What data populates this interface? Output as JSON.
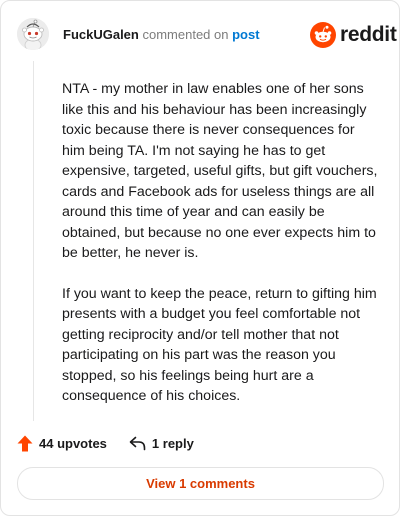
{
  "header": {
    "username": "FuckUGalen",
    "action_text": "commented on",
    "post_link": "post",
    "brand": "reddit",
    "brand_color": "#ff4500"
  },
  "comment": {
    "paragraphs": [
      "NTA - my mother in law enables one of her sons like this and his behaviour has been increasingly toxic because there is never consequences for him being TA. I'm not saying he has to get expensive, targeted, useful gifts, but gift vouchers, cards and Facebook ads for useless things are all around this time of year and can easily be obtained, but because no one ever expects him to be better, he never is.",
      "If you want to keep the peace, return to gifting him presents with a budget you feel comfortable not getting reciprocity and/or tell mother that not participating on his part was the reason you stopped, so his feelings being hurt are a consequence of his choices."
    ]
  },
  "footer": {
    "upvotes_label": "44 upvotes",
    "reply_label": "1 reply",
    "view_comments_label": "View 1 comments",
    "upvote_color": "#ff4500",
    "view_color": "#d93a00"
  },
  "icons": {
    "avatar": "snoo-avatar-icon",
    "logo": "reddit-snoo-icon",
    "upvote": "upvote-arrow-icon",
    "reply": "reply-arrow-icon"
  }
}
